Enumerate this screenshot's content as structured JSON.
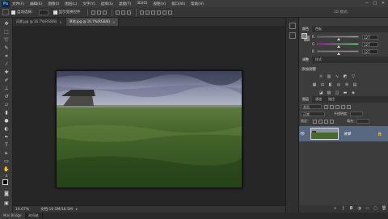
{
  "app": {
    "logo": "Ps"
  },
  "menu": [
    "文件(F)",
    "编辑(E)",
    "图像(I)",
    "图层(L)",
    "文字(Y)",
    "选择(S)",
    "滤镜(T)",
    "3D(D)",
    "视图(V)",
    "窗口(W)",
    "帮助(H)"
  ],
  "window_controls": [
    "—",
    "□",
    "✕"
  ],
  "options": {
    "auto_select_label": "自动选择：",
    "show_transform_label": "显示变换控件",
    "mode_3d": "3D 模式："
  },
  "tabs": [
    {
      "label": "风景.jpg @ 16.7%(RGB/8)",
      "close": "×"
    },
    {
      "label": "草地.jpg @ 16.7%(RGB/8)",
      "close": "×"
    }
  ],
  "status": {
    "zoom": "16.67%",
    "doc": "文档:16.5M/16.5M",
    "arrow": "▸"
  },
  "bottom_tabs": [
    "Mini Bridge",
    "时间轴"
  ],
  "color_panel": {
    "tabs": [
      "颜色",
      "色板"
    ],
    "sliders": [
      {
        "label": "R",
        "value": "127",
        "fraction": 0.5
      },
      {
        "label": "G",
        "value": "127",
        "fraction": 0.5
      },
      {
        "label": "B",
        "value": "127",
        "fraction": 0.5
      }
    ]
  },
  "adjust_panel": {
    "tabs": [
      "调整",
      "样式"
    ],
    "title": "添加调整"
  },
  "layers_panel": {
    "tabs": [
      "图层",
      "通道",
      "路径"
    ],
    "kind_label": "类型",
    "mode": "正常",
    "opacity_label": "不透明度：",
    "lock_label": "锁定：",
    "fill_label": "填充：",
    "layer_name": "背景",
    "eye": "👁",
    "lock_icon": "🔒"
  }
}
